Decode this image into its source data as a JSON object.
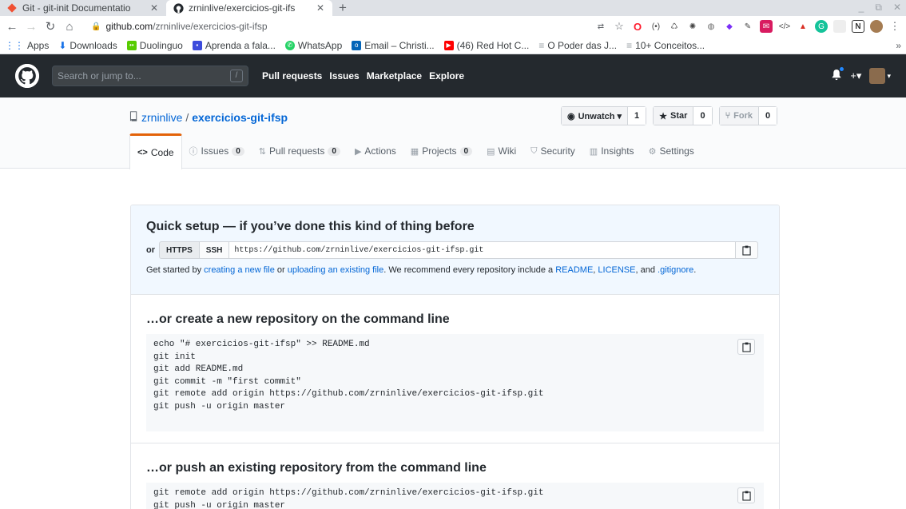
{
  "browser": {
    "tabs": [
      {
        "title": "Git - git-init Documentatio",
        "active": false
      },
      {
        "title": "zrninlive/exercicios-git-ifs",
        "active": true
      }
    ],
    "url_host": "github.com",
    "url_path": "/zrninlive/exercicios-git-ifsp",
    "bookmarks": [
      {
        "label": "Apps"
      },
      {
        "label": "Downloads"
      },
      {
        "label": "Duolinguo"
      },
      {
        "label": "Aprenda a fala..."
      },
      {
        "label": "WhatsApp"
      },
      {
        "label": "Email – Christi..."
      },
      {
        "label": "(46) Red Hot C..."
      },
      {
        "label": "O Poder das J..."
      },
      {
        "label": "10+ Conceitos..."
      }
    ]
  },
  "header": {
    "search_placeholder": "Search or jump to...",
    "search_shortcut": "/",
    "nav": [
      "Pull requests",
      "Issues",
      "Marketplace",
      "Explore"
    ],
    "plus": "+▾"
  },
  "repo": {
    "owner": "zrninlive",
    "separator": "/",
    "name": "exercicios-git-ifsp",
    "watch_label": "Unwatch ▾",
    "watch_count": "1",
    "star_label": "Star",
    "star_count": "0",
    "fork_label": "Fork",
    "fork_count": "0",
    "tabs": [
      {
        "label": "Code",
        "icon": "<>",
        "count": null
      },
      {
        "label": "Issues",
        "icon": "ⓘ",
        "count": "0"
      },
      {
        "label": "Pull requests",
        "icon": "⇅",
        "count": "0"
      },
      {
        "label": "Actions",
        "icon": "▶",
        "count": null
      },
      {
        "label": "Projects",
        "icon": "▦",
        "count": "0"
      },
      {
        "label": "Wiki",
        "icon": "▤",
        "count": null
      },
      {
        "label": "Security",
        "icon": "⛉",
        "count": null
      },
      {
        "label": "Insights",
        "icon": "▥",
        "count": null
      },
      {
        "label": "Settings",
        "icon": "⚙",
        "count": null
      }
    ]
  },
  "quick_setup": {
    "title": "Quick setup — if you’ve done this kind of thing before",
    "or": "or",
    "https": "HTTPS",
    "ssh": "SSH",
    "clone_url": "https://github.com/zrninlive/exercicios-git-ifsp.git",
    "text_1": "Get started by ",
    "link_new_file": "creating a new file",
    "text_2": " or ",
    "link_upload": "uploading an existing file",
    "text_3": ". We recommend every repository include a ",
    "link_readme": "README",
    "text_4": ", ",
    "link_license": "LICENSE",
    "text_5": ", and ",
    "link_gitignore": ".gitignore",
    "text_6": "."
  },
  "create_new": {
    "title": "…or create a new repository on the command line",
    "code": "echo \"# exercicios-git-ifsp\" >> README.md\ngit init\ngit add README.md\ngit commit -m \"first commit\"\ngit remote add origin https://github.com/zrninlive/exercicios-git-ifsp.git\ngit push -u origin master"
  },
  "push_existing": {
    "title": "…or push an existing repository from the command line",
    "code": "git remote add origin https://github.com/zrninlive/exercicios-git-ifsp.git\ngit push -u origin master"
  }
}
